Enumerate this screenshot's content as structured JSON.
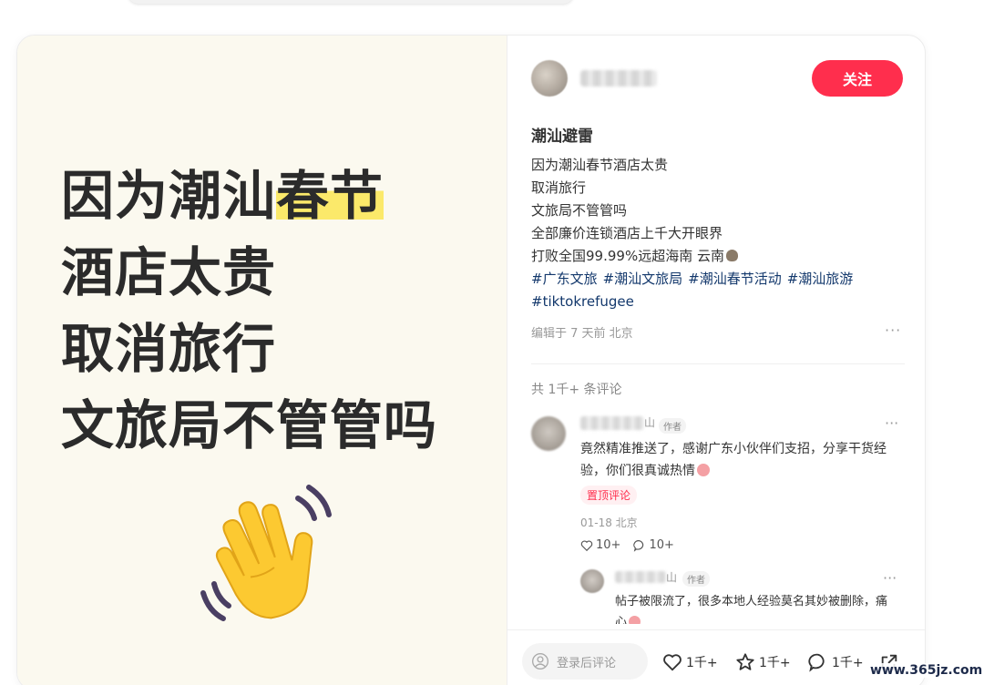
{
  "cover": {
    "lines": [
      "因为潮汕",
      "春节",
      "酒店太贵",
      "取消旅行",
      "文旅局不管管吗"
    ],
    "emoji": "waving-hand"
  },
  "author": {
    "follow_label": "关注"
  },
  "note": {
    "title": "潮汕避雷",
    "body": [
      "因为潮汕春节酒店太贵",
      "取消旅行",
      "文旅局不管管吗",
      "全部廉价连锁酒店上千大开眼界",
      "打败全国99.99%远超海南 云南"
    ],
    "tags": [
      "#广东文旅",
      "#潮汕文旅局",
      "#潮汕春节活动",
      "#潮汕旅游",
      "#tiktokrefugee"
    ],
    "meta": "编辑于 7 天前 北京",
    "more": "···"
  },
  "comments_header": "共 1千+ 条评论",
  "comment": {
    "name_tail": "山",
    "badge": "作者",
    "text": "竟然精准推送了，感谢广东小伙伴们支招，分享干货经验，你们很真诚热情",
    "pinned": "置顶评论",
    "time": "01-18 北京",
    "likes": "10+",
    "replies": "10+",
    "more": "···"
  },
  "reply": {
    "name_tail": "山",
    "badge": "作者",
    "text": "帖子被限流了，很多本地人经验莫名其妙被删除，痛心",
    "more": "···"
  },
  "bottom": {
    "input_placeholder": "登录后评论",
    "likes": "1千+",
    "collects": "1千+",
    "comments": "1千+"
  },
  "watermark": "www.365jz.com",
  "colors": {
    "accent": "#ff2e4d",
    "tag": "#13386c",
    "cover_bg": "#fbf9ef",
    "highlight": "#fbe96a"
  }
}
